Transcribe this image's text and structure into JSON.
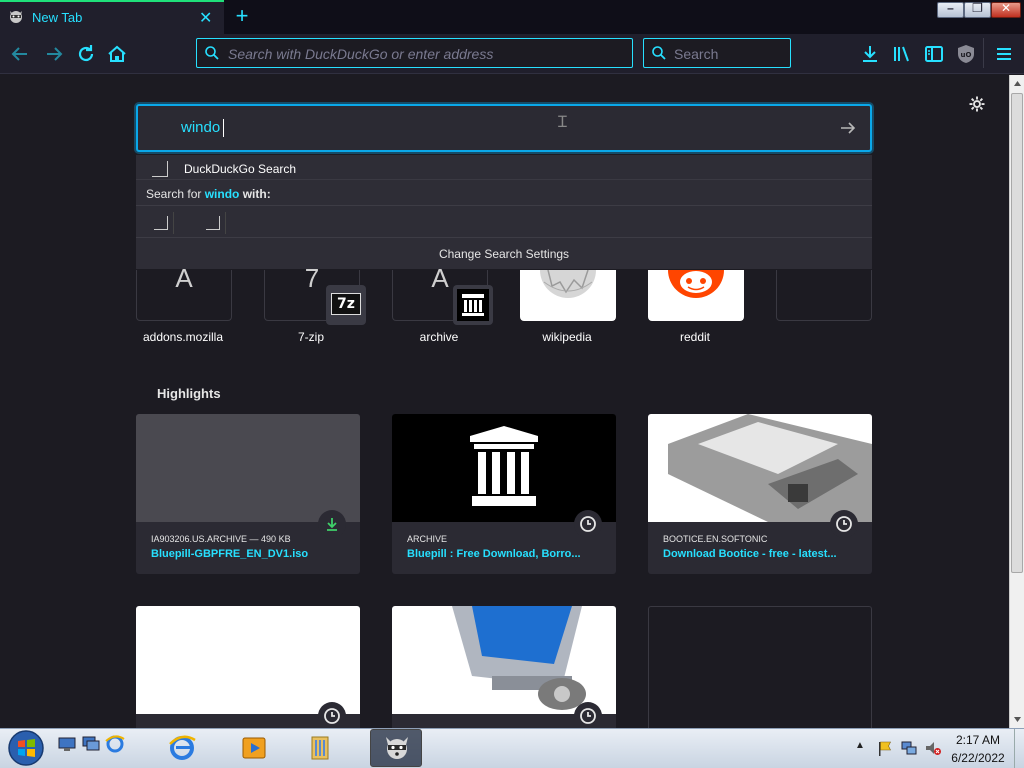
{
  "browser": {
    "tab_title": "New Tab",
    "tab_close": "✕",
    "new_tab": "+",
    "urlbar_placeholder": "Search with DuckDuckGo or enter address",
    "searchbar_placeholder": "Search"
  },
  "search": {
    "value": "windo",
    "engine_label": "DuckDuckGo Search",
    "search_for_prefix": "Search for ",
    "search_for_query": "windo",
    "search_for_suffix": " with:",
    "change_settings": "Change Search Settings"
  },
  "top_sites": [
    {
      "label": "addons.mozilla",
      "letter": "A"
    },
    {
      "label": "7-zip",
      "letter": "7"
    },
    {
      "label": "archive",
      "letter": "A"
    },
    {
      "label": "wikipedia",
      "letter": ""
    },
    {
      "label": "reddit",
      "letter": ""
    },
    {
      "label": "",
      "letter": ""
    }
  ],
  "highlights": {
    "title": "Highlights",
    "cards": [
      {
        "host": "IA903206.US.ARCHIVE — 490 KB",
        "title": "Bluepill-GBPFRE_EN_DV1.iso"
      },
      {
        "host": "ARCHIVE",
        "title": "Bluepill : Free Download, Borro..."
      },
      {
        "host": "BOOTICE.EN.SOFTONIC",
        "title": "Download Bootice - free - latest..."
      }
    ]
  },
  "taskbar": {
    "time": "2:17 AM",
    "date": "6/22/2022"
  },
  "colors": {
    "accent": "#27e0ff",
    "tab_indicator": "#1fe07a",
    "focus_border": "#0aa8ea",
    "reddit": "#ff4500"
  }
}
